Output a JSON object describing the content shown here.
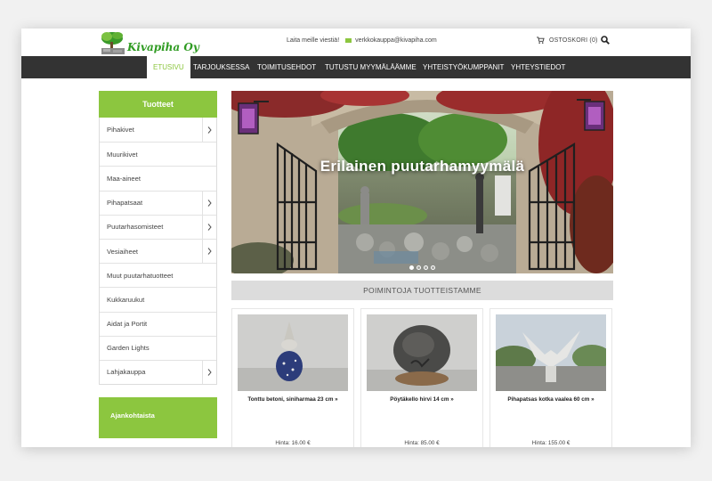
{
  "header": {
    "logo_text": "Kivapiha Oy",
    "contact_label": "Laita meille viestiä!",
    "email": "verkkokauppa@kivapiha.com",
    "cart_label": "OSTOSKORI (0)"
  },
  "nav": {
    "items": [
      {
        "label": "ETUSIVU",
        "active": true
      },
      {
        "label": "TARJOUKSESSA"
      },
      {
        "label": "TOIMITUSEHDOT"
      },
      {
        "label": "TUTUSTU MYYMÄLÄÄMME"
      },
      {
        "label": "YHTEISTYÖKUMPPANIT"
      },
      {
        "label": "YHTEYSTIEDOT"
      }
    ]
  },
  "sidebar": {
    "title": "Tuotteet",
    "items": [
      {
        "label": "Pihakivet",
        "has_sub": true
      },
      {
        "label": "Muurikivet",
        "has_sub": false
      },
      {
        "label": "Maa-aineet",
        "has_sub": false
      },
      {
        "label": "Pihapatsaat",
        "has_sub": true
      },
      {
        "label": "Puutarhasomisteet",
        "has_sub": true
      },
      {
        "label": "Vesiaiheet",
        "has_sub": true
      },
      {
        "label": "Muut puutarhatuotteet",
        "has_sub": false
      },
      {
        "label": "Kukkaruukut",
        "has_sub": false
      },
      {
        "label": "Aidat ja Portit",
        "has_sub": false
      },
      {
        "label": "Garden Lights",
        "has_sub": false
      },
      {
        "label": "Lahjakauppa",
        "has_sub": true
      }
    ],
    "news_title": "Ajankohtaista"
  },
  "hero": {
    "title": "Erilainen puutarhamyymälä",
    "slide_count": 4,
    "active_slide": 1
  },
  "picks": {
    "title": "POIMINTOJA TUOTTEISTAMME"
  },
  "products": [
    {
      "name": "Tonttu betoni, siniharmaa 23 cm »",
      "price": "Hinta: 16.00 €"
    },
    {
      "name": "Pöytäkello hirvi 14 cm »",
      "price": "Hinta: 85.00 €"
    },
    {
      "name": "Pihapatsas kotka vaalea 60 cm »",
      "price": "Hinta: 155.00 €"
    }
  ],
  "colors": {
    "accent": "#8cc63f",
    "nav_bg": "#333333"
  }
}
